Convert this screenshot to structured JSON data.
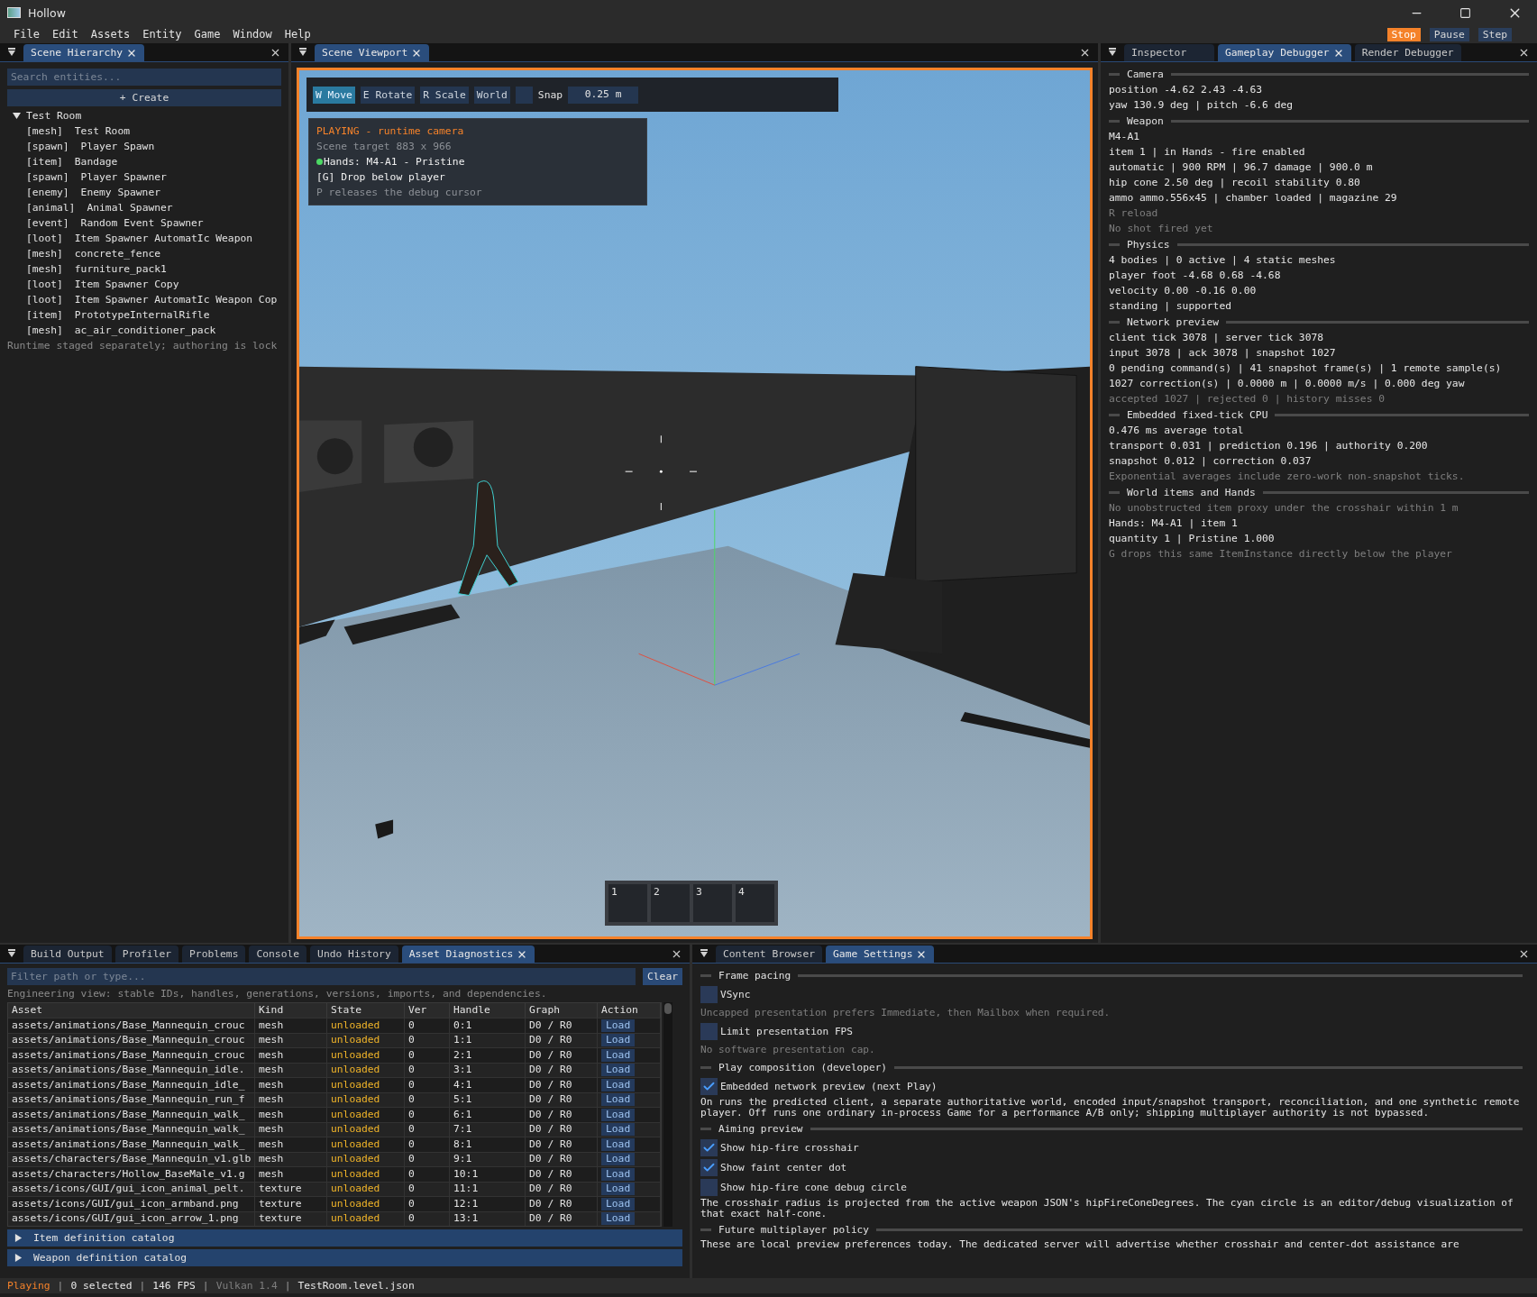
{
  "window": {
    "title": "Hollow"
  },
  "menu": [
    "File",
    "Edit",
    "Assets",
    "Entity",
    "Game",
    "Window",
    "Help"
  ],
  "play_controls": [
    {
      "label": "Stop",
      "active": true
    },
    {
      "label": "Pause",
      "active": false
    },
    {
      "label": "Step",
      "active": false
    }
  ],
  "hierarchy": {
    "tabs": [
      {
        "label": "Scene Hierarchy",
        "selected": true,
        "closable": true
      }
    ],
    "search": {
      "placeholder": "Search entities..."
    },
    "create_button": "+ Create",
    "tree": [
      {
        "label": "Test Room",
        "expanded": true,
        "children": [
          {
            "tag": "[mesh]",
            "name": "Test Room"
          },
          {
            "tag": "[spawn]",
            "name": "Player Spawn"
          },
          {
            "tag": "[item]",
            "name": "Bandage"
          },
          {
            "tag": "[spawn]",
            "name": "Player Spawner"
          },
          {
            "tag": "[enemy]",
            "name": "Enemy Spawner"
          },
          {
            "tag": "[animal]",
            "name": "Animal Spawner"
          },
          {
            "tag": "[event]",
            "name": "Random Event Spawner"
          },
          {
            "tag": "[loot]",
            "name": "Item Spawner AutomatIc Weapon"
          },
          {
            "tag": "[mesh]",
            "name": "concrete_fence"
          },
          {
            "tag": "[mesh]",
            "name": "furniture_pack1"
          },
          {
            "tag": "[loot]",
            "name": "Item Spawner Copy"
          },
          {
            "tag": "[loot]",
            "name": "Item Spawner AutomatIc Weapon Cop"
          },
          {
            "tag": "[item]",
            "name": "PrototypeInternalRifle"
          },
          {
            "tag": "[mesh]",
            "name": "ac_air_conditioner_pack"
          }
        ]
      }
    ],
    "footer": "Runtime staged separately; authoring is lock"
  },
  "viewport": {
    "tabs": [
      {
        "label": "Scene Viewport",
        "selected": true,
        "closable": true
      }
    ],
    "toolbar": [
      {
        "label": "W Move",
        "selected": true
      },
      {
        "label": "E Rotate",
        "selected": false
      },
      {
        "label": "R Scale",
        "selected": false
      },
      {
        "label": "World",
        "selected": false
      }
    ],
    "snap": {
      "label": "Snap",
      "checked": false,
      "value": "0.25 m"
    },
    "overlay": [
      {
        "text": "PLAYING - runtime camera",
        "kind": "status"
      },
      {
        "text": "Scene target 883 x 966",
        "kind": "muted"
      },
      {
        "text": "Hands: M4-A1 - Pristine",
        "kind": "indicator"
      },
      {
        "text": "[G] Drop below player",
        "kind": "normal"
      },
      {
        "text": "P releases the debug cursor",
        "kind": "muted"
      }
    ],
    "hotbar": [
      "1",
      "2",
      "3",
      "4"
    ]
  },
  "debugger": {
    "tabs": [
      {
        "label": "Inspector",
        "selected": false,
        "closable": false
      },
      {
        "label": "Gameplay Debugger",
        "selected": true,
        "closable": true
      },
      {
        "label": "Render Debugger",
        "selected": false,
        "closable": false
      }
    ],
    "sections": [
      {
        "title": "Camera",
        "lines": [
          {
            "text": "position -4.62  2.43  -4.63",
            "muted": false
          },
          {
            "text": "yaw 130.9 deg | pitch -6.6 deg",
            "muted": false
          }
        ]
      },
      {
        "title": "Weapon",
        "lines": [
          {
            "text": "M4-A1",
            "muted": false
          },
          {
            "text": "item 1 | in Hands - fire enabled",
            "muted": false
          },
          {
            "text": "automatic | 900 RPM | 96.7 damage | 900.0 m",
            "muted": false
          },
          {
            "text": "hip cone 2.50 deg | recoil stability 0.80",
            "muted": false
          },
          {
            "text": "ammo ammo.556x45 | chamber loaded | magazine 29",
            "muted": false
          },
          {
            "text": "R reload",
            "muted": true
          },
          {
            "text": "No shot fired yet",
            "muted": true
          }
        ]
      },
      {
        "title": "Physics",
        "lines": [
          {
            "text": "4 bodies | 0 active | 4 static meshes",
            "muted": false
          },
          {
            "text": "player foot -4.68 0.68 -4.68",
            "muted": false
          },
          {
            "text": "velocity 0.00 -0.16 0.00",
            "muted": false
          },
          {
            "text": "standing | supported",
            "muted": false
          }
        ]
      },
      {
        "title": "Network preview",
        "lines": [
          {
            "text": "client tick 3078 | server tick 3078",
            "muted": false
          },
          {
            "text": "input 3078 | ack 3078 | snapshot 1027",
            "muted": false
          },
          {
            "text": "0 pending command(s) | 41 snapshot frame(s) | 1 remote sample(s)",
            "muted": false
          },
          {
            "text": "1027 correction(s) | 0.0000 m | 0.0000 m/s | 0.000 deg yaw",
            "muted": false
          },
          {
            "text": "accepted 1027 | rejected 0 | history misses 0",
            "muted": true
          }
        ]
      },
      {
        "title": "Embedded fixed-tick CPU",
        "lines": [
          {
            "text": "0.476 ms average total",
            "muted": false
          },
          {
            "text": "transport 0.031 | prediction 0.196 | authority 0.200",
            "muted": false
          },
          {
            "text": "snapshot 0.012 | correction 0.037",
            "muted": false
          },
          {
            "text": "Exponential averages include zero-work non-snapshot ticks.",
            "muted": true
          }
        ]
      },
      {
        "title": "World items and Hands",
        "lines": [
          {
            "text": "No unobstructed item proxy under the crosshair within 1 m",
            "muted": true
          },
          {
            "text": "Hands: M4-A1 | item 1",
            "muted": false
          },
          {
            "text": "quantity 1 | Pristine 1.000",
            "muted": false
          },
          {
            "text": "G drops this same ItemInstance directly below the player",
            "muted": true
          }
        ]
      }
    ]
  },
  "assets": {
    "tabs": [
      {
        "label": "Build Output",
        "selected": false,
        "closable": false
      },
      {
        "label": "Profiler",
        "selected": false,
        "closable": false
      },
      {
        "label": "Problems",
        "selected": false,
        "closable": false
      },
      {
        "label": "Console",
        "selected": false,
        "closable": false
      },
      {
        "label": "Undo History",
        "selected": false,
        "closable": false
      },
      {
        "label": "Asset Diagnostics",
        "selected": true,
        "closable": true
      }
    ],
    "filter": {
      "placeholder": "Filter path or type..."
    },
    "clear_button": "Clear",
    "note": "Engineering view: stable IDs, handles, generations, versions, imports, and dependencies.",
    "columns": [
      "Asset",
      "Kind",
      "State",
      "Ver",
      "Handle",
      "Graph",
      "Action"
    ],
    "rows": [
      [
        "assets/animations/Base_Mannequin_crouc",
        "mesh",
        "unloaded",
        "0",
        "0:1",
        "D0 / R0",
        "Load"
      ],
      [
        "assets/animations/Base_Mannequin_crouc",
        "mesh",
        "unloaded",
        "0",
        "1:1",
        "D0 / R0",
        "Load"
      ],
      [
        "assets/animations/Base_Mannequin_crouc",
        "mesh",
        "unloaded",
        "0",
        "2:1",
        "D0 / R0",
        "Load"
      ],
      [
        "assets/animations/Base_Mannequin_idle.",
        "mesh",
        "unloaded",
        "0",
        "3:1",
        "D0 / R0",
        "Load"
      ],
      [
        "assets/animations/Base_Mannequin_idle_",
        "mesh",
        "unloaded",
        "0",
        "4:1",
        "D0 / R0",
        "Load"
      ],
      [
        "assets/animations/Base_Mannequin_run_f",
        "mesh",
        "unloaded",
        "0",
        "5:1",
        "D0 / R0",
        "Load"
      ],
      [
        "assets/animations/Base_Mannequin_walk_",
        "mesh",
        "unloaded",
        "0",
        "6:1",
        "D0 / R0",
        "Load"
      ],
      [
        "assets/animations/Base_Mannequin_walk_",
        "mesh",
        "unloaded",
        "0",
        "7:1",
        "D0 / R0",
        "Load"
      ],
      [
        "assets/animations/Base_Mannequin_walk_",
        "mesh",
        "unloaded",
        "0",
        "8:1",
        "D0 / R0",
        "Load"
      ],
      [
        "assets/characters/Base_Mannequin_v1.glb",
        "mesh",
        "unloaded",
        "0",
        "9:1",
        "D0 / R0",
        "Load"
      ],
      [
        "assets/characters/Hollow_BaseMale_v1.g",
        "mesh",
        "unloaded",
        "0",
        "10:1",
        "D0 / R0",
        "Load"
      ],
      [
        "assets/icons/GUI/gui_icon_animal_pelt.",
        "texture",
        "unloaded",
        "0",
        "11:1",
        "D0 / R0",
        "Load"
      ],
      [
        "assets/icons/GUI/gui_icon_armband.png",
        "texture",
        "unloaded",
        "0",
        "12:1",
        "D0 / R0",
        "Load"
      ],
      [
        "assets/icons/GUI/gui_icon_arrow_1.png",
        "texture",
        "unloaded",
        "0",
        "13:1",
        "D0 / R0",
        "Load"
      ]
    ],
    "catalogs": [
      {
        "label": "Item definition catalog",
        "expanded": false
      },
      {
        "label": "Weapon definition catalog",
        "expanded": false
      }
    ]
  },
  "settings": {
    "tabs": [
      {
        "label": "Content Browser",
        "selected": false,
        "closable": false
      },
      {
        "label": "Game Settings",
        "selected": true,
        "closable": true
      }
    ],
    "items": [
      {
        "kind": "header",
        "text": "Frame pacing"
      },
      {
        "kind": "checkbox",
        "text": "VSync",
        "checked": false
      },
      {
        "kind": "note",
        "text": "Uncapped presentation prefers Immediate, then Mailbox when required."
      },
      {
        "kind": "checkbox",
        "text": "Limit presentation FPS",
        "checked": false
      },
      {
        "kind": "note",
        "text": "No software presentation cap."
      },
      {
        "kind": "header",
        "text": "Play composition (developer)"
      },
      {
        "kind": "checkbox",
        "text": "Embedded network preview (next Play)",
        "checked": true
      },
      {
        "kind": "text",
        "text": "On runs the predicted client, a separate authoritative world, encoded input/snapshot transport, reconciliation, and one synthetic remote player. Off runs one ordinary in-process Game for a performance A/B only; shipping multiplayer authority is not bypassed."
      },
      {
        "kind": "header",
        "text": "Aiming preview"
      },
      {
        "kind": "checkbox",
        "text": "Show hip-fire crosshair",
        "checked": true
      },
      {
        "kind": "checkbox",
        "text": "Show faint center dot",
        "checked": true
      },
      {
        "kind": "checkbox",
        "text": "Show hip-fire cone debug circle",
        "checked": false
      },
      {
        "kind": "text",
        "text": "The crosshair radius is projected from the active weapon JSON's hipFireConeDegrees. The cyan circle is an editor/debug visualization of that exact half-cone."
      },
      {
        "kind": "header",
        "text": "Future multiplayer policy"
      },
      {
        "kind": "text",
        "text": "These are local preview preferences today. The dedicated server will advertise whether crosshair and center-dot assistance are"
      }
    ]
  },
  "status_bar": [
    {
      "text": "Playing",
      "kind": "accent"
    },
    {
      "text": "|",
      "kind": "separator"
    },
    {
      "text": "0 selected",
      "kind": "normal"
    },
    {
      "text": "|",
      "kind": "separator"
    },
    {
      "text": "146 FPS",
      "kind": "normal"
    },
    {
      "text": "|",
      "kind": "separator"
    },
    {
      "text": "Vulkan 1.4",
      "kind": "muted"
    },
    {
      "text": "|",
      "kind": "separator"
    },
    {
      "text": "TestRoom.level.json",
      "kind": "normal"
    }
  ]
}
